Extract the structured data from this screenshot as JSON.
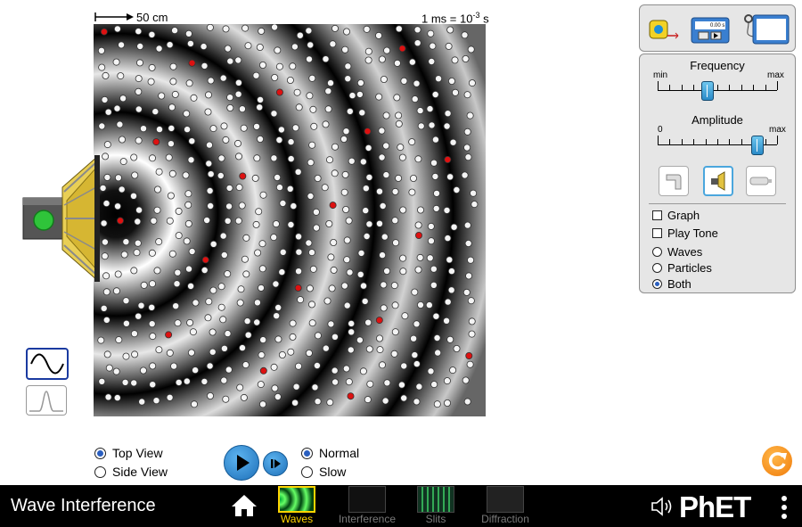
{
  "scale": {
    "length_label": "50 cm",
    "time_label_base": "1 ms = 10",
    "time_label_exp": "-3",
    "time_label_unit": " s"
  },
  "controls": {
    "frequency": {
      "title": "Frequency",
      "min_label": "min",
      "max_label": "max",
      "value": 0.41
    },
    "amplitude": {
      "title": "Amplitude",
      "min_label": "0",
      "max_label": "max",
      "value": 0.83
    },
    "source_buttons": [
      "water-faucet",
      "sound-speaker",
      "light-laser"
    ],
    "selected_source": "sound-speaker",
    "graph_label": "Graph",
    "play_tone_label": "Play Tone",
    "view_options": [
      "Waves",
      "Particles",
      "Both"
    ],
    "selected_view": "Both"
  },
  "toolbox": {
    "stopwatch_readout": "0.00 s"
  },
  "bottom": {
    "top_view_label": "Top View",
    "side_view_label": "Side View",
    "selected_view": "Top View",
    "normal_label": "Normal",
    "slow_label": "Slow",
    "selected_speed": "Normal"
  },
  "navbar": {
    "sim_title": "Wave Interference",
    "screens": [
      "Waves",
      "Interference",
      "Slits",
      "Diffraction"
    ],
    "active_screen": "Waves",
    "brand": "PhET"
  },
  "colors": {
    "accent_blue": "#2a8ac8",
    "active_screen": "#ffd400",
    "reset_orange": "#f07b0a",
    "particle_red": "#dd1111"
  }
}
